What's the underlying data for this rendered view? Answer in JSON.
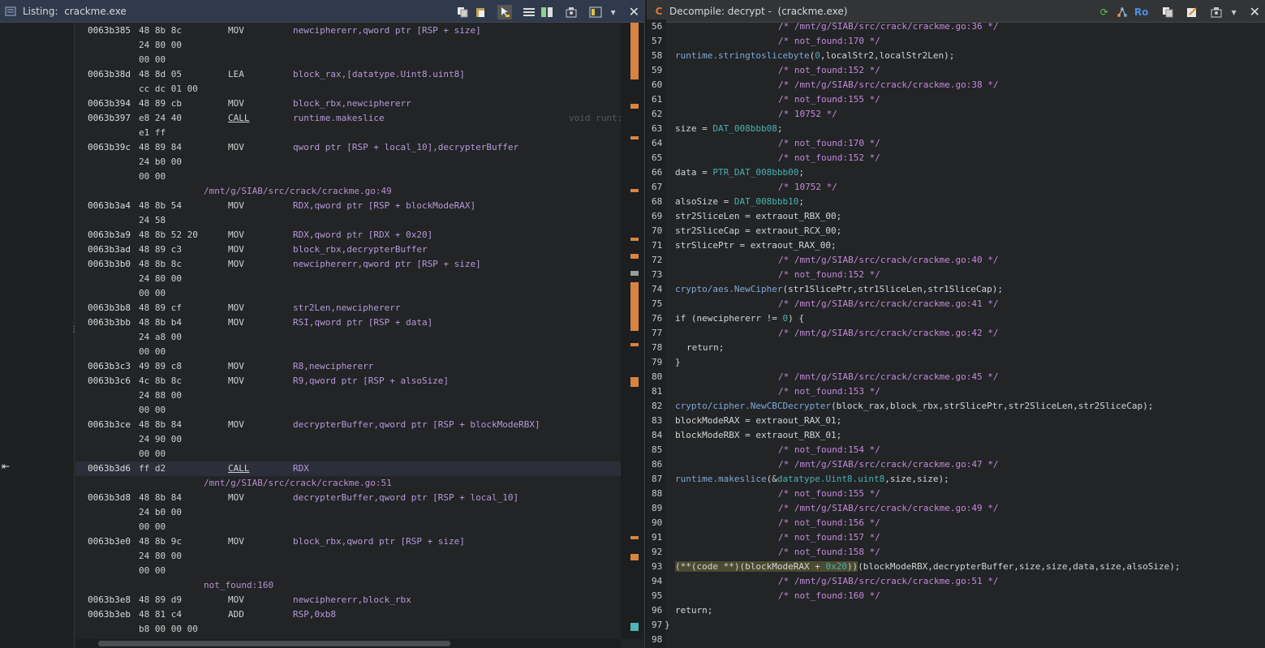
{
  "listing": {
    "title": "Listing:  crackme.exe",
    "icons": [
      "copy-icon",
      "paste-icon",
      "cursor-icon",
      "listing-fields-icon",
      "diff-icon",
      "snapshot-icon",
      "layout-icon",
      "menu-chevron-icon",
      "close-icon"
    ],
    "rows": [
      {
        "addr": "0063b385",
        "bytes": "48 8b 8c",
        "mnem": "MOV",
        "ops": "newciphererr,qword ptr [RSP + size]"
      },
      {
        "bytes": "24 80 00"
      },
      {
        "bytes": "00 00"
      },
      {
        "addr": "0063b38d",
        "bytes": "48 8d 05",
        "mnem": "LEA",
        "ops": "block_rax,[datatype.Uint8.uint8]"
      },
      {
        "bytes": "cc dc 01 00"
      },
      {
        "addr": "0063b394",
        "bytes": "48 89 cb",
        "mnem": "MOV",
        "ops": "block_rbx,newciphererr"
      },
      {
        "addr": "0063b397",
        "bytes": "e8 24 40",
        "mnem": "CALL",
        "ops": "runtime.makeslice",
        "comment": "void runt:"
      },
      {
        "bytes": "e1 ff"
      },
      {
        "addr": "0063b39c",
        "bytes": "48 89 84",
        "mnem": "MOV",
        "ops": "qword ptr [RSP + local_10],decrypterBuffer"
      },
      {
        "bytes": "24 b0 00"
      },
      {
        "bytes": "00 00"
      },
      {
        "label": "/mnt/g/SIAB/src/crack/crackme.go:49"
      },
      {
        "addr": "0063b3a4",
        "bytes": "48 8b 54",
        "mnem": "MOV",
        "ops": "RDX,qword ptr [RSP + blockModeRAX]"
      },
      {
        "bytes": "24 58"
      },
      {
        "addr": "0063b3a9",
        "bytes": "48 8b 52 20",
        "mnem": "MOV",
        "ops": "RDX,qword ptr [RDX + 0x20]"
      },
      {
        "addr": "0063b3ad",
        "bytes": "48 89 c3",
        "mnem": "MOV",
        "ops": "block_rbx,decrypterBuffer"
      },
      {
        "addr": "0063b3b0",
        "bytes": "48 8b 8c",
        "mnem": "MOV",
        "ops": "newciphererr,qword ptr [RSP + size]"
      },
      {
        "bytes": "24 80 00"
      },
      {
        "bytes": "00 00"
      },
      {
        "addr": "0063b3b8",
        "bytes": "48 89 cf",
        "mnem": "MOV",
        "ops": "str2Len,newciphererr"
      },
      {
        "addr": "0063b3bb",
        "bytes": "48 8b b4",
        "mnem": "MOV",
        "ops": "RSI,qword ptr [RSP + data]"
      },
      {
        "bytes": "24 a8 00"
      },
      {
        "bytes": "00 00"
      },
      {
        "addr": "0063b3c3",
        "bytes": "49 89 c8",
        "mnem": "MOV",
        "ops": "R8,newciphererr"
      },
      {
        "addr": "0063b3c6",
        "bytes": "4c 8b 8c",
        "mnem": "MOV",
        "ops": "R9,qword ptr [RSP + alsoSize]"
      },
      {
        "bytes": "24 88 00"
      },
      {
        "bytes": "00 00"
      },
      {
        "addr": "0063b3ce",
        "bytes": "48 8b 84",
        "mnem": "MOV",
        "ops": "decrypterBuffer,qword ptr [RSP + blockModeRBX]"
      },
      {
        "bytes": "24 90 00"
      },
      {
        "bytes": "00 00"
      },
      {
        "addr": "0063b3d6",
        "bytes": "ff d2",
        "mnem": "CALL",
        "ops": "RDX",
        "selected": true
      },
      {
        "label": "/mnt/g/SIAB/src/crack/crackme.go:51"
      },
      {
        "addr": "0063b3d8",
        "bytes": "48 8b 84",
        "mnem": "MOV",
        "ops": "decrypterBuffer,qword ptr [RSP + local_10]"
      },
      {
        "bytes": "24 b0 00"
      },
      {
        "bytes": "00 00"
      },
      {
        "addr": "0063b3e0",
        "bytes": "48 8b 9c",
        "mnem": "MOV",
        "ops": "block_rbx,qword ptr [RSP + size]"
      },
      {
        "bytes": "24 80 00"
      },
      {
        "bytes": "00 00"
      },
      {
        "label": "not_found:160"
      },
      {
        "addr": "0063b3e8",
        "bytes": "48 89 d9",
        "mnem": "MOV",
        "ops": "newciphererr,block_rbx"
      },
      {
        "addr": "0063b3eb",
        "bytes": "48 81 c4",
        "mnem": "ADD",
        "ops": "RSP,0xb8"
      },
      {
        "bytes": "b8 00 00 00"
      }
    ],
    "accent_color": "#d9843e"
  },
  "decompile": {
    "title": "Decompile: decrypt -  (crackme.exe)",
    "icons": [
      "refresh-icon",
      "graph-icon",
      "ro-toggle",
      "copy-icon",
      "edit-icon",
      "snapshot-icon",
      "menu-chevron-icon",
      "close-icon"
    ],
    "ro_label": "Ro",
    "lines": [
      {
        "n": "56",
        "indent": "            ",
        "text": "/* /mnt/g/SIAB/src/crack/crackme.go:36 */",
        "kind": "cmt"
      },
      {
        "n": "57",
        "indent": "            ",
        "text": "/* not_found:170 */",
        "kind": "cmt"
      },
      {
        "n": "58",
        "indent": "",
        "text": "runtime.stringtoslicebyte(0,localStr2,localStr2Len);",
        "kind": "code"
      },
      {
        "n": "59",
        "indent": "            ",
        "text": "/* not_found:152 */",
        "kind": "cmt"
      },
      {
        "n": "60",
        "indent": "            ",
        "text": "/* /mnt/g/SIAB/src/crack/crackme.go:38 */",
        "kind": "cmt"
      },
      {
        "n": "61",
        "indent": "            ",
        "text": "/* not_found:155 */",
        "kind": "cmt"
      },
      {
        "n": "62",
        "indent": "            ",
        "text": "/* 10752 */",
        "kind": "cmt"
      },
      {
        "n": "63",
        "indent": "",
        "text": "size = DAT_008bbb08;",
        "kind": "code"
      },
      {
        "n": "64",
        "indent": "            ",
        "text": "/* not_found:170 */",
        "kind": "cmt"
      },
      {
        "n": "65",
        "indent": "            ",
        "text": "/* not_found:152 */",
        "kind": "cmt"
      },
      {
        "n": "66",
        "indent": "",
        "text": "data = PTR_DAT_008bbb00;",
        "kind": "code"
      },
      {
        "n": "67",
        "indent": "            ",
        "text": "/* 10752 */",
        "kind": "cmt"
      },
      {
        "n": "68",
        "indent": "",
        "text": "alsoSize = DAT_008bbb10;",
        "kind": "code"
      },
      {
        "n": "69",
        "indent": "",
        "text": "str2SliceLen = extraout_RBX_00;",
        "kind": "code"
      },
      {
        "n": "70",
        "indent": "",
        "text": "str2SliceCap = extraout_RCX_00;",
        "kind": "code"
      },
      {
        "n": "71",
        "indent": "",
        "text": "strSlicePtr = extraout_RAX_00;",
        "kind": "code"
      },
      {
        "n": "72",
        "indent": "            ",
        "text": "/* /mnt/g/SIAB/src/crack/crackme.go:40 */",
        "kind": "cmt"
      },
      {
        "n": "73",
        "indent": "            ",
        "text": "/* not_found:152 */",
        "kind": "cmt"
      },
      {
        "n": "74",
        "indent": "",
        "text": "crypto/aes.NewCipher(str1SlicePtr,str1SliceLen,str1SliceCap);",
        "kind": "code"
      },
      {
        "n": "75",
        "indent": "            ",
        "text": "/* /mnt/g/SIAB/src/crack/crackme.go:41 */",
        "kind": "cmt"
      },
      {
        "n": "76",
        "indent": "",
        "text": "if (newciphererr != 0) {",
        "kind": "code"
      },
      {
        "n": "77",
        "indent": "            ",
        "text": "/* /mnt/g/SIAB/src/crack/crackme.go:42 */",
        "kind": "cmt"
      },
      {
        "n": "78",
        "indent": "  ",
        "text": "return;",
        "kind": "code"
      },
      {
        "n": "79",
        "indent": "",
        "text": "}",
        "kind": "code"
      },
      {
        "n": "80",
        "indent": "            ",
        "text": "/* /mnt/g/SIAB/src/crack/crackme.go:45 */",
        "kind": "cmt"
      },
      {
        "n": "81",
        "indent": "            ",
        "text": "/* not_found:153 */",
        "kind": "cmt"
      },
      {
        "n": "82",
        "indent": "",
        "text": "crypto/cipher.NewCBCDecrypter(block_rax,block_rbx,strSlicePtr,str2SliceLen,str2SliceCap);",
        "kind": "code"
      },
      {
        "n": "83",
        "indent": "",
        "text": "blockModeRAX = extraout_RAX_01;",
        "kind": "code"
      },
      {
        "n": "84",
        "indent": "",
        "text": "blockModeRBX = extraout_RBX_01;",
        "kind": "code"
      },
      {
        "n": "85",
        "indent": "            ",
        "text": "/* not_found:154 */",
        "kind": "cmt"
      },
      {
        "n": "86",
        "indent": "            ",
        "text": "/* /mnt/g/SIAB/src/crack/crackme.go:47 */",
        "kind": "cmt"
      },
      {
        "n": "87",
        "indent": "",
        "text": "runtime.makeslice(&datatype.Uint8.uint8,size,size);",
        "kind": "code"
      },
      {
        "n": "88",
        "indent": "            ",
        "text": "/* not_found:155 */",
        "kind": "cmt"
      },
      {
        "n": "89",
        "indent": "            ",
        "text": "/* /mnt/g/SIAB/src/crack/crackme.go:49 */",
        "kind": "cmt"
      },
      {
        "n": "90",
        "indent": "            ",
        "text": "/* not_found:156 */",
        "kind": "cmt"
      },
      {
        "n": "91",
        "indent": "            ",
        "text": "/* not_found:157 */",
        "kind": "cmt"
      },
      {
        "n": "92",
        "indent": "            ",
        "text": "/* not_found:158 */",
        "kind": "cmt"
      },
      {
        "n": "93",
        "indent": "",
        "text": "(**(code **)(blockModeRAX + 0x20))(blockModeRBX,decrypterBuffer,size,size,data,size,alsoSize);",
        "kind": "code",
        "highlight": "(**(code **)(blockModeRAX + 0x20))"
      },
      {
        "n": "94",
        "indent": "            ",
        "text": "/* /mnt/g/SIAB/src/crack/crackme.go:51 */",
        "kind": "cmt"
      },
      {
        "n": "95",
        "indent": "            ",
        "text": "/* not_found:160 */",
        "kind": "cmt"
      },
      {
        "n": "96",
        "indent": "",
        "text": "return;",
        "kind": "code"
      },
      {
        "n": "97",
        "indent": "",
        "text": "}",
        "kind": "brace"
      },
      {
        "n": "98",
        "indent": "",
        "text": "",
        "kind": "code"
      }
    ]
  }
}
